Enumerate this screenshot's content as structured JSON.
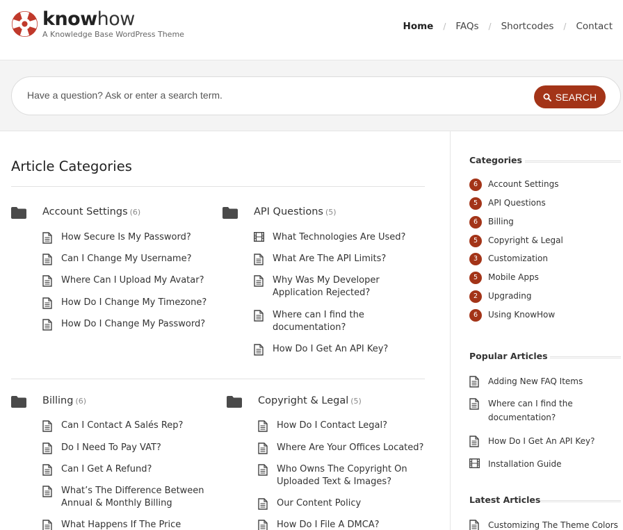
{
  "brand": {
    "name_bold": "know",
    "name_light": "how",
    "tagline": "A Knowledge Base WordPress Theme",
    "accent": "#a33418"
  },
  "nav": {
    "items": [
      "Home",
      "FAQs",
      "Shortcodes",
      "Contact"
    ],
    "separator": "/"
  },
  "search": {
    "placeholder": "Have a question? Ask or enter a search term.",
    "button_label": "SEARCH"
  },
  "main": {
    "title": "Article Categories",
    "categories": [
      {
        "name": "Account Settings",
        "count": "(6)",
        "articles": [
          {
            "title": "How Secure Is My Password?",
            "icon": "document-icon"
          },
          {
            "title": "Can I Change My Username?",
            "icon": "document-icon"
          },
          {
            "title": "Where Can I Upload My Avatar?",
            "icon": "document-icon"
          },
          {
            "title": "How Do I Change My Timezone?",
            "icon": "document-icon"
          },
          {
            "title": "How Do I Change My Password?",
            "icon": "document-icon"
          }
        ]
      },
      {
        "name": "API Questions",
        "count": "(5)",
        "articles": [
          {
            "title": "What Technologies Are Used?",
            "icon": "film-icon"
          },
          {
            "title": "What Are The API Limits?",
            "icon": "document-icon"
          },
          {
            "title_lines": [
              "Why Was My Developer",
              "Application Rejected?"
            ],
            "icon": "document-icon"
          },
          {
            "title_lines": [
              "Where can I find the",
              "documentation?"
            ],
            "icon": "document-icon"
          },
          {
            "title": "How Do I Get An API Key?",
            "icon": "document-icon"
          }
        ]
      },
      {
        "name": "Billing",
        "count": "(6)",
        "articles": [
          {
            "title": "Can I Contact A Salés Rep?",
            "icon": "document-icon"
          },
          {
            "title": "Do I Need To Pay VAT?",
            "icon": "document-icon"
          },
          {
            "title": "Can I Get A Refund?",
            "icon": "document-icon"
          },
          {
            "title_lines": [
              "What’s The Difference Between",
              "Annual & Monthly Billing"
            ],
            "icon": "document-icon"
          },
          {
            "title": "What Happens If The Price",
            "icon": "document-icon"
          }
        ]
      },
      {
        "name": "Copyright & Legal",
        "count": "(5)",
        "articles": [
          {
            "title": "How Do I Contact Legal?",
            "icon": "document-icon"
          },
          {
            "title": "Where Are Your Offices Located?",
            "icon": "document-icon"
          },
          {
            "title_lines": [
              "Who Owns The Copyright On",
              "Uploaded Text & Images?"
            ],
            "icon": "document-icon"
          },
          {
            "title": "Our Content Policy",
            "icon": "document-icon"
          },
          {
            "title": "How Do I File A DMCA?",
            "icon": "document-icon"
          }
        ]
      }
    ]
  },
  "sidebar": {
    "categories_heading": "Categories",
    "categories": [
      {
        "count": "6",
        "name": "Account Settings"
      },
      {
        "count": "5",
        "name": "API Questions"
      },
      {
        "count": "6",
        "name": "Billing"
      },
      {
        "count": "5",
        "name": "Copyright & Legal"
      },
      {
        "count": "3",
        "name": "Customization"
      },
      {
        "count": "5",
        "name": "Mobile Apps"
      },
      {
        "count": "2",
        "name": "Upgrading"
      },
      {
        "count": "6",
        "name": "Using KnowHow"
      }
    ],
    "popular_heading": "Popular Articles",
    "popular": [
      {
        "title": "Adding New FAQ Items",
        "icon": "document-icon"
      },
      {
        "title_lines": [
          "Where can I find the",
          "documentation?"
        ],
        "icon": "document-icon"
      },
      {
        "title": "How Do I Get An API Key?",
        "icon": "document-icon"
      },
      {
        "title": "Installation Guide",
        "icon": "film-icon"
      }
    ],
    "latest_heading": "Latest Articles",
    "latest": [
      {
        "title": "Customizing The Theme Colors",
        "icon": "document-icon"
      }
    ]
  }
}
